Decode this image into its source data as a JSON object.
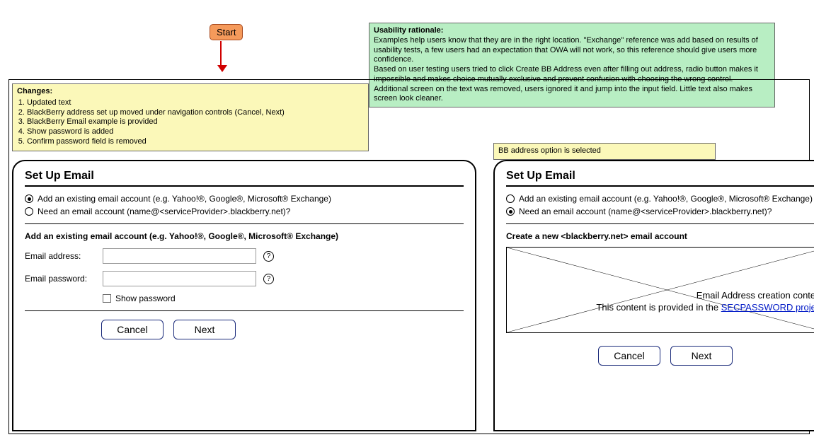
{
  "start_label": "Start",
  "changes_note": {
    "title": "Changes:",
    "items": [
      "Updated text",
      "BlackBerry address set up moved under navigation controls (Cancel, Next)",
      "BlackBerry Email example is provided",
      "Show password is added",
      "Confirm password field is removed"
    ]
  },
  "usability_note": {
    "title": "Usability rationale:",
    "body": "Examples help users know that they are in the right location. \"Exchange\" reference was add based on results of usability tests, a few users had an expectation that OWA will not work, so this reference should give users more confidence.\nBased on user testing users tried to click Create BB Address even after filling out address, radio button makes it impossible and makes choice mutually exclusive and prevent confusion with choosing the wrong control.\nAdditional screen on the text was removed, users ignored it and jump into the input field. Little text also makes screen look cleaner."
  },
  "bb_note": "BB address option is selected",
  "panels": {
    "left": {
      "title": "Set Up Email",
      "options": [
        {
          "label": "Add an existing email account (e.g. Yahoo!®, Google®, Microsoft® Exchange)",
          "selected": true
        },
        {
          "label": "Need an email account (name@<serviceProvider>.blackberry.net)?",
          "selected": false
        }
      ],
      "subhead": "Add an existing email account (e.g. Yahoo!®, Google®, Microsoft® Exchange)",
      "fields": {
        "email_label": "Email address:",
        "password_label": "Email password:",
        "show_password": "Show password"
      },
      "buttons": {
        "cancel": "Cancel",
        "next": "Next"
      }
    },
    "right": {
      "title": "Set Up Email",
      "options": [
        {
          "label": "Add an existing email account (e.g. Yahoo!®, Google®, Microsoft® Exchange)",
          "selected": false
        },
        {
          "label": "Need an email account (name@<serviceProvider>.blackberry.net)?",
          "selected": true
        }
      ],
      "subhead": "Create a new <blackberry.net> email account",
      "placeholder_line1": "Email Address creation content",
      "placeholder_line2_pre": "This content is provided in the ",
      "placeholder_link": "SECPASSWORD project",
      "buttons": {
        "cancel": "Cancel",
        "next": "Next"
      }
    }
  }
}
